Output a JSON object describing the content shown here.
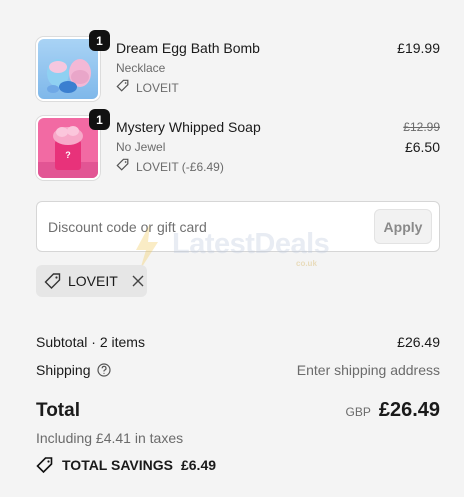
{
  "items": [
    {
      "quantity": "1",
      "name": "Dream Egg Bath Bomb",
      "variant": "Necklace",
      "discount": "LOVEIT",
      "price": "£19.99"
    },
    {
      "quantity": "1",
      "name": "Mystery Whipped Soap",
      "variant": "No Jewel",
      "discount": "LOVEIT (-£6.49)",
      "original_price": "£12.99",
      "price": "£6.50"
    }
  ],
  "discount_input": {
    "placeholder": "Discount code or gift card",
    "apply_label": "Apply"
  },
  "watermark": {
    "text": "LatestDeals",
    "sub": "co.uk"
  },
  "applied_code": "LOVEIT",
  "summary": {
    "subtotal_label": "Subtotal · 2 items",
    "subtotal_value": "£26.49",
    "shipping_label": "Shipping",
    "shipping_value": "Enter shipping address",
    "total_label": "Total",
    "currency": "GBP",
    "total_value": "£26.49",
    "taxes": "Including £4.41 in taxes",
    "savings_label": "TOTAL SAVINGS",
    "savings_value": "£6.49"
  },
  "colors": {
    "background": "#f4f4f4",
    "text": "#1a1a1a",
    "muted": "#6b6b6b",
    "badge": "#111111"
  }
}
